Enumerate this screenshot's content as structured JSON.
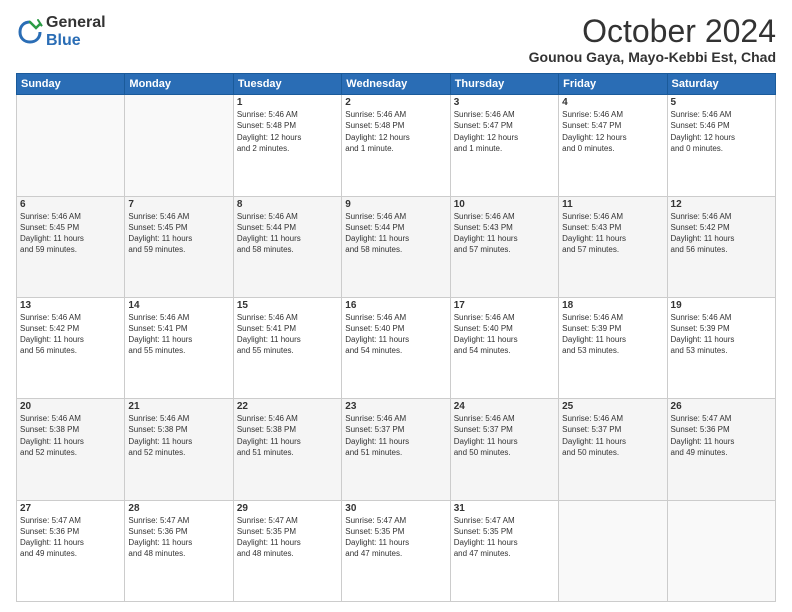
{
  "header": {
    "logo_general": "General",
    "logo_blue": "Blue",
    "main_title": "October 2024",
    "subtitle": "Gounou Gaya, Mayo-Kebbi Est, Chad"
  },
  "days_of_week": [
    "Sunday",
    "Monday",
    "Tuesday",
    "Wednesday",
    "Thursday",
    "Friday",
    "Saturday"
  ],
  "weeks": [
    [
      {
        "day": "",
        "info": ""
      },
      {
        "day": "",
        "info": ""
      },
      {
        "day": "1",
        "info": "Sunrise: 5:46 AM\nSunset: 5:48 PM\nDaylight: 12 hours\nand 2 minutes."
      },
      {
        "day": "2",
        "info": "Sunrise: 5:46 AM\nSunset: 5:48 PM\nDaylight: 12 hours\nand 1 minute."
      },
      {
        "day": "3",
        "info": "Sunrise: 5:46 AM\nSunset: 5:47 PM\nDaylight: 12 hours\nand 1 minute."
      },
      {
        "day": "4",
        "info": "Sunrise: 5:46 AM\nSunset: 5:47 PM\nDaylight: 12 hours\nand 0 minutes."
      },
      {
        "day": "5",
        "info": "Sunrise: 5:46 AM\nSunset: 5:46 PM\nDaylight: 12 hours\nand 0 minutes."
      }
    ],
    [
      {
        "day": "6",
        "info": "Sunrise: 5:46 AM\nSunset: 5:45 PM\nDaylight: 11 hours\nand 59 minutes."
      },
      {
        "day": "7",
        "info": "Sunrise: 5:46 AM\nSunset: 5:45 PM\nDaylight: 11 hours\nand 59 minutes."
      },
      {
        "day": "8",
        "info": "Sunrise: 5:46 AM\nSunset: 5:44 PM\nDaylight: 11 hours\nand 58 minutes."
      },
      {
        "day": "9",
        "info": "Sunrise: 5:46 AM\nSunset: 5:44 PM\nDaylight: 11 hours\nand 58 minutes."
      },
      {
        "day": "10",
        "info": "Sunrise: 5:46 AM\nSunset: 5:43 PM\nDaylight: 11 hours\nand 57 minutes."
      },
      {
        "day": "11",
        "info": "Sunrise: 5:46 AM\nSunset: 5:43 PM\nDaylight: 11 hours\nand 57 minutes."
      },
      {
        "day": "12",
        "info": "Sunrise: 5:46 AM\nSunset: 5:42 PM\nDaylight: 11 hours\nand 56 minutes."
      }
    ],
    [
      {
        "day": "13",
        "info": "Sunrise: 5:46 AM\nSunset: 5:42 PM\nDaylight: 11 hours\nand 56 minutes."
      },
      {
        "day": "14",
        "info": "Sunrise: 5:46 AM\nSunset: 5:41 PM\nDaylight: 11 hours\nand 55 minutes."
      },
      {
        "day": "15",
        "info": "Sunrise: 5:46 AM\nSunset: 5:41 PM\nDaylight: 11 hours\nand 55 minutes."
      },
      {
        "day": "16",
        "info": "Sunrise: 5:46 AM\nSunset: 5:40 PM\nDaylight: 11 hours\nand 54 minutes."
      },
      {
        "day": "17",
        "info": "Sunrise: 5:46 AM\nSunset: 5:40 PM\nDaylight: 11 hours\nand 54 minutes."
      },
      {
        "day": "18",
        "info": "Sunrise: 5:46 AM\nSunset: 5:39 PM\nDaylight: 11 hours\nand 53 minutes."
      },
      {
        "day": "19",
        "info": "Sunrise: 5:46 AM\nSunset: 5:39 PM\nDaylight: 11 hours\nand 53 minutes."
      }
    ],
    [
      {
        "day": "20",
        "info": "Sunrise: 5:46 AM\nSunset: 5:38 PM\nDaylight: 11 hours\nand 52 minutes."
      },
      {
        "day": "21",
        "info": "Sunrise: 5:46 AM\nSunset: 5:38 PM\nDaylight: 11 hours\nand 52 minutes."
      },
      {
        "day": "22",
        "info": "Sunrise: 5:46 AM\nSunset: 5:38 PM\nDaylight: 11 hours\nand 51 minutes."
      },
      {
        "day": "23",
        "info": "Sunrise: 5:46 AM\nSunset: 5:37 PM\nDaylight: 11 hours\nand 51 minutes."
      },
      {
        "day": "24",
        "info": "Sunrise: 5:46 AM\nSunset: 5:37 PM\nDaylight: 11 hours\nand 50 minutes."
      },
      {
        "day": "25",
        "info": "Sunrise: 5:46 AM\nSunset: 5:37 PM\nDaylight: 11 hours\nand 50 minutes."
      },
      {
        "day": "26",
        "info": "Sunrise: 5:47 AM\nSunset: 5:36 PM\nDaylight: 11 hours\nand 49 minutes."
      }
    ],
    [
      {
        "day": "27",
        "info": "Sunrise: 5:47 AM\nSunset: 5:36 PM\nDaylight: 11 hours\nand 49 minutes."
      },
      {
        "day": "28",
        "info": "Sunrise: 5:47 AM\nSunset: 5:36 PM\nDaylight: 11 hours\nand 48 minutes."
      },
      {
        "day": "29",
        "info": "Sunrise: 5:47 AM\nSunset: 5:35 PM\nDaylight: 11 hours\nand 48 minutes."
      },
      {
        "day": "30",
        "info": "Sunrise: 5:47 AM\nSunset: 5:35 PM\nDaylight: 11 hours\nand 47 minutes."
      },
      {
        "day": "31",
        "info": "Sunrise: 5:47 AM\nSunset: 5:35 PM\nDaylight: 11 hours\nand 47 minutes."
      },
      {
        "day": "",
        "info": ""
      },
      {
        "day": "",
        "info": ""
      }
    ]
  ]
}
